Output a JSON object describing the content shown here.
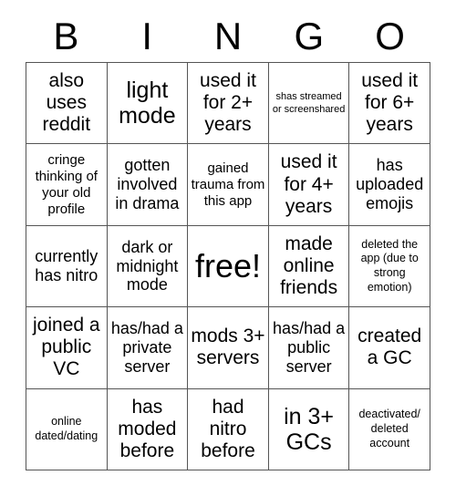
{
  "card": {
    "header_letters": [
      "B",
      "I",
      "N",
      "G",
      "O"
    ],
    "columns": 5,
    "rows": 5,
    "text_color": "#000000",
    "background_color": "#ffffff",
    "border_color": "#555555",
    "cells": [
      {
        "text": "also uses reddit",
        "size": "l"
      },
      {
        "text": "light mode",
        "size": "xl"
      },
      {
        "text": "used it for 2+ years",
        "size": "l"
      },
      {
        "text": "shas streamed or screenshared",
        "size": "xxs"
      },
      {
        "text": "used it for 6+ years",
        "size": "l"
      },
      {
        "text": "cringe thinking of your old profile",
        "size": "s"
      },
      {
        "text": "gotten involved in drama",
        "size": "m"
      },
      {
        "text": "gained trauma from this app",
        "size": "s"
      },
      {
        "text": "used it for 4+ years",
        "size": "l"
      },
      {
        "text": "has uploaded emojis",
        "size": "m"
      },
      {
        "text": "currently has nitro",
        "size": "m"
      },
      {
        "text": "dark or midnight mode",
        "size": "m"
      },
      {
        "text": "free!",
        "size": "xxl"
      },
      {
        "text": "made online friends",
        "size": "l"
      },
      {
        "text": "deleted the app (due to strong emotion)",
        "size": "xs"
      },
      {
        "text": "joined a public VC",
        "size": "l"
      },
      {
        "text": "has/had a private server",
        "size": "m"
      },
      {
        "text": "mods 3+ servers",
        "size": "l"
      },
      {
        "text": "has/had a public server",
        "size": "m"
      },
      {
        "text": "created a GC",
        "size": "l"
      },
      {
        "text": "online dated/dating",
        "size": "xs"
      },
      {
        "text": "has moded before",
        "size": "l"
      },
      {
        "text": "had nitro before",
        "size": "l"
      },
      {
        "text": "in 3+ GCs",
        "size": "xl"
      },
      {
        "text": "deactivated/ deleted account",
        "size": "xs"
      }
    ]
  }
}
